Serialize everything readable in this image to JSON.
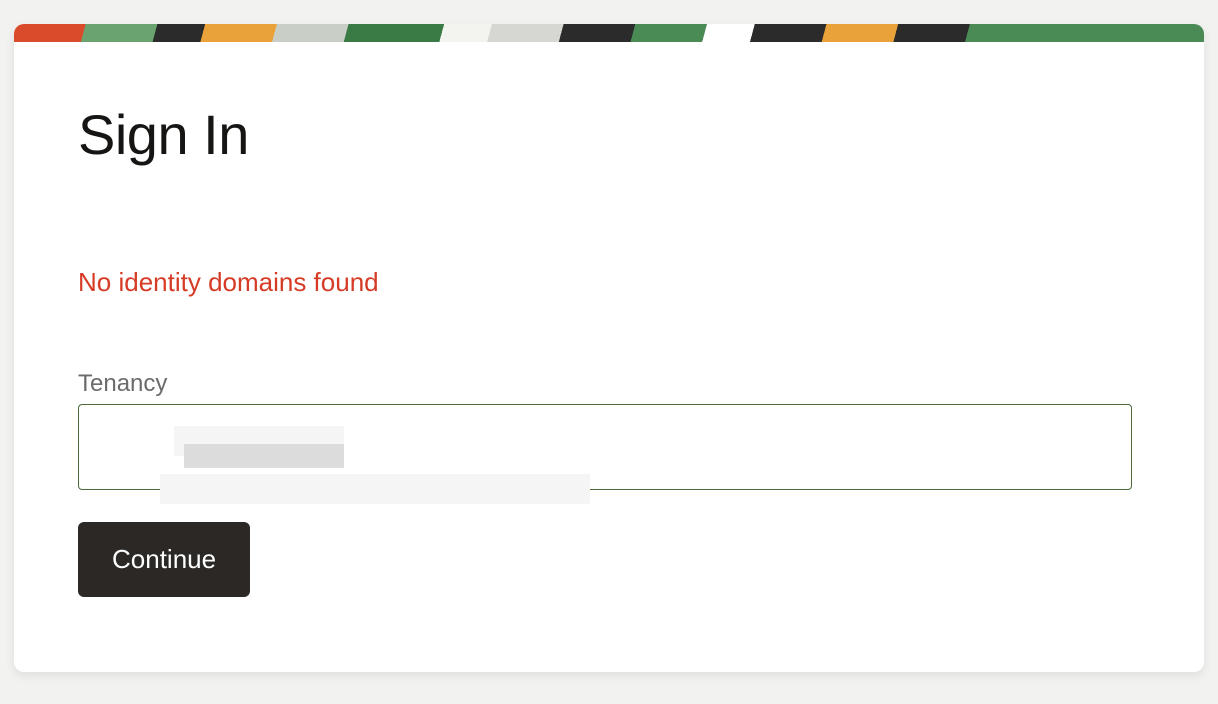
{
  "page": {
    "title": "Sign In",
    "error_message": "No identity domains found"
  },
  "form": {
    "tenancy_label": "Tenancy",
    "tenancy_value": "",
    "continue_label": "Continue"
  },
  "colors": {
    "error": "#d63b25",
    "input_border": "#4a6b39",
    "button_bg": "#2b2826",
    "button_fg": "#ffffff"
  }
}
